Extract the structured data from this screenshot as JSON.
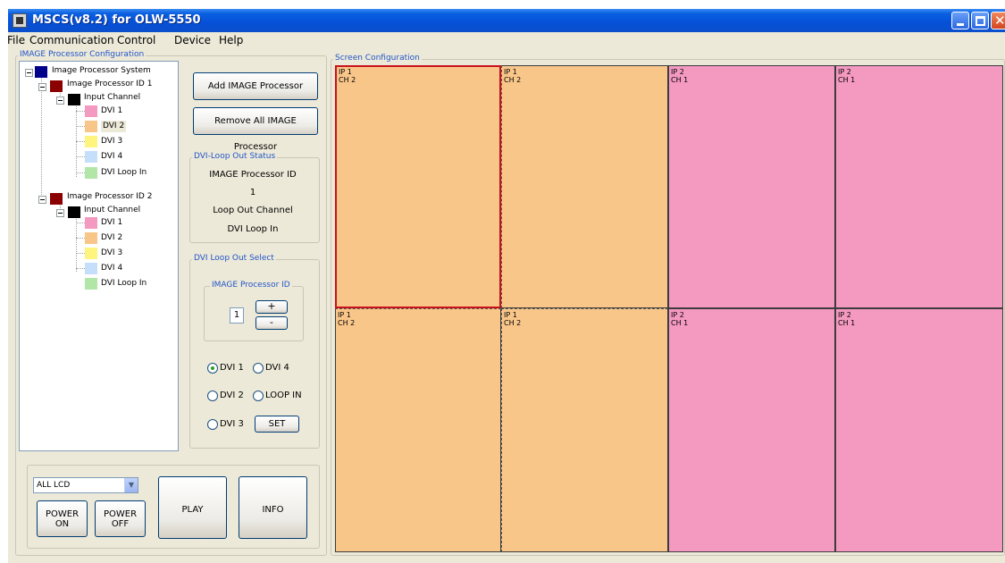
{
  "window": {
    "title": "MSCS(v8.2) for OLW-5550"
  },
  "menu": [
    "File",
    "Communication",
    "Control",
    "Device",
    "Help"
  ],
  "left_group": {
    "title": "IMAGE Processor Configuration"
  },
  "tree": {
    "root": "Image Processor System",
    "processors": [
      {
        "label": "Image Processor ID 1",
        "channel_label": "Input Channel",
        "channels": [
          "DVI 1",
          "DVI 2",
          "DVI 3",
          "DVI 4",
          "DVI Loop In"
        ]
      },
      {
        "label": "Image Processor ID 2",
        "channel_label": "Input Channel",
        "channels": [
          "DVI 1",
          "DVI 2",
          "DVI 3",
          "DVI 4",
          "DVI Loop In"
        ]
      }
    ],
    "colors": {
      "root": "#00008b",
      "processor": "#8b0000",
      "channel": "#000000",
      "dvi1": "#f499c0",
      "dvi2": "#f9c68a",
      "dvi3": "#fdf57e",
      "dvi4": "#c5dffb",
      "loop": "#b1e6a8"
    }
  },
  "buttons": {
    "add": "Add IMAGE Processor",
    "remove_all": "Remove All IMAGE Processor"
  },
  "loop_status": {
    "title": "DVI-Loop Out Status",
    "id_label": "IMAGE Processor ID",
    "id_value": "1",
    "channel_label": "Loop Out Channel",
    "channel_value": "DVI Loop In"
  },
  "loop_select": {
    "title": "DVI Loop Out Select",
    "id_group_title": "IMAGE Processor ID",
    "id_value": "1",
    "plus": "+",
    "minus": "-",
    "radios": [
      "DVI 1",
      "DVI 4",
      "DVI 2",
      "LOOP IN",
      "DVI 3"
    ],
    "selected": "DVI 1",
    "set_label": "SET"
  },
  "bottom": {
    "select_value": "ALL LCD",
    "power_on": [
      "POWER",
      "ON"
    ],
    "power_off": [
      "POWER",
      "OFF"
    ],
    "play": "PLAY",
    "info": "INFO"
  },
  "screen": {
    "title": "Screen Configuration",
    "cells": [
      {
        "ip": "IP 1",
        "ch": "CH 2",
        "color": "#f9c68a",
        "selected": true
      },
      {
        "ip": "IP 1",
        "ch": "CH 2",
        "color": "#f9c68a",
        "selected": false
      },
      {
        "ip": "IP 2",
        "ch": "CH 1",
        "color": "#f499c0",
        "selected": false
      },
      {
        "ip": "IP 2",
        "ch": "CH 1",
        "color": "#f499c0",
        "selected": false
      },
      {
        "ip": "IP 1",
        "ch": "CH 2",
        "color": "#f9c68a",
        "selected": false
      },
      {
        "ip": "IP 1",
        "ch": "CH 2",
        "color": "#f9c68a",
        "selected": false
      },
      {
        "ip": "IP 2",
        "ch": "CH 1",
        "color": "#f499c0",
        "selected": false
      },
      {
        "ip": "IP 2",
        "ch": "CH 1",
        "color": "#f499c0",
        "selected": false
      }
    ]
  }
}
